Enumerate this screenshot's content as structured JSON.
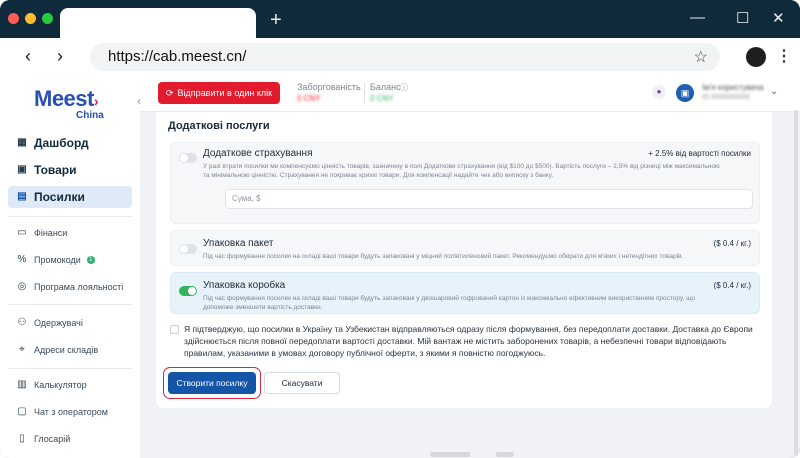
{
  "browser": {
    "url": "https://cab.meest.cn/",
    "new_tab": "+",
    "minimize": "—",
    "maximize": "☐",
    "close": "✕",
    "back": "‹",
    "forward": "›",
    "star": "☆",
    "menu": "⋮"
  },
  "logo": {
    "main": "Meest",
    "sub": "China"
  },
  "sidebar": {
    "collapse": "‹",
    "main_items": [
      {
        "label": "Дашборд"
      },
      {
        "label": "Товари"
      },
      {
        "label": "Посилки",
        "active": true
      }
    ],
    "sub_items": [
      {
        "label": "Фінанси"
      },
      {
        "label": "Промокоди",
        "badge": "1"
      },
      {
        "label": "Програма лояльності"
      },
      {
        "label": "Одержувачі"
      },
      {
        "label": "Адреси складів"
      },
      {
        "label": "Калькулятор"
      },
      {
        "label": "Чат з оператором"
      },
      {
        "label": "Глосарій"
      }
    ]
  },
  "header": {
    "send_button": "Відправити в один клік",
    "debt_label": "Заборгованість",
    "debt_value": "0 CNY",
    "balance_label": "Баланс",
    "balance_value": "0 CNY",
    "user_initial": "▣",
    "user_name": "Ім'я користувача",
    "user_id": "ID 0000000000",
    "chevron": "⌄"
  },
  "services": {
    "title": "Додаткові послуги",
    "options": [
      {
        "title": "Додаткове страхування",
        "price": "+ 2.5% від вартості посилки",
        "desc": "У разі втрати посилки ми компенсуємо цінність товарів, зазначену в полі Додаткове страхування (від $100 до $500). Вартість послуги – 2,5% від різниці між максимальною та мінімальною цінністю. Страхування не покриває крихкі товари. Для компенсації надайте чек або виписку з банку.",
        "enabled": false,
        "input_placeholder": "Сума, $"
      },
      {
        "title": "Упаковка пакет",
        "price": "($ 0.4 / кг.)",
        "desc": "Під час формування посилки на складі ваші товари будуть запаковані у міцний поліетиленовий пакет. Рекомендуємо обирати для м'яких і нетендітних товарів.",
        "enabled": false
      },
      {
        "title": "Упаковка коробка",
        "price": "($ 0.4 / кг.)",
        "desc": "Під час формування посилки на складі ваші товари будуть запаковані у двошаровий гофрований картон із максимально ефективним використанням простору, що допоможе зменшити вартість доставки.",
        "enabled": true
      }
    ]
  },
  "consent": {
    "text": "Я підтверджую, що посилки в Україну та Узбекистан відправляються одразу після формування, без передоплати доставки. Доставка до Європи здійснюється після повної передоплати вартості доставки. Мій вантаж не містить заборонених товарів, а небезпечні товари відповідають правилам, указаними в умовах договору публічної оферти, з якими я повністю погоджуюсь."
  },
  "actions": {
    "create": "Створити посилку",
    "cancel": "Скасувати"
  },
  "colors": {
    "brand": "#2a4fb3",
    "cta_red": "#e31b2e",
    "primary": "#1555a8",
    "toggle_on": "#34b35a"
  }
}
